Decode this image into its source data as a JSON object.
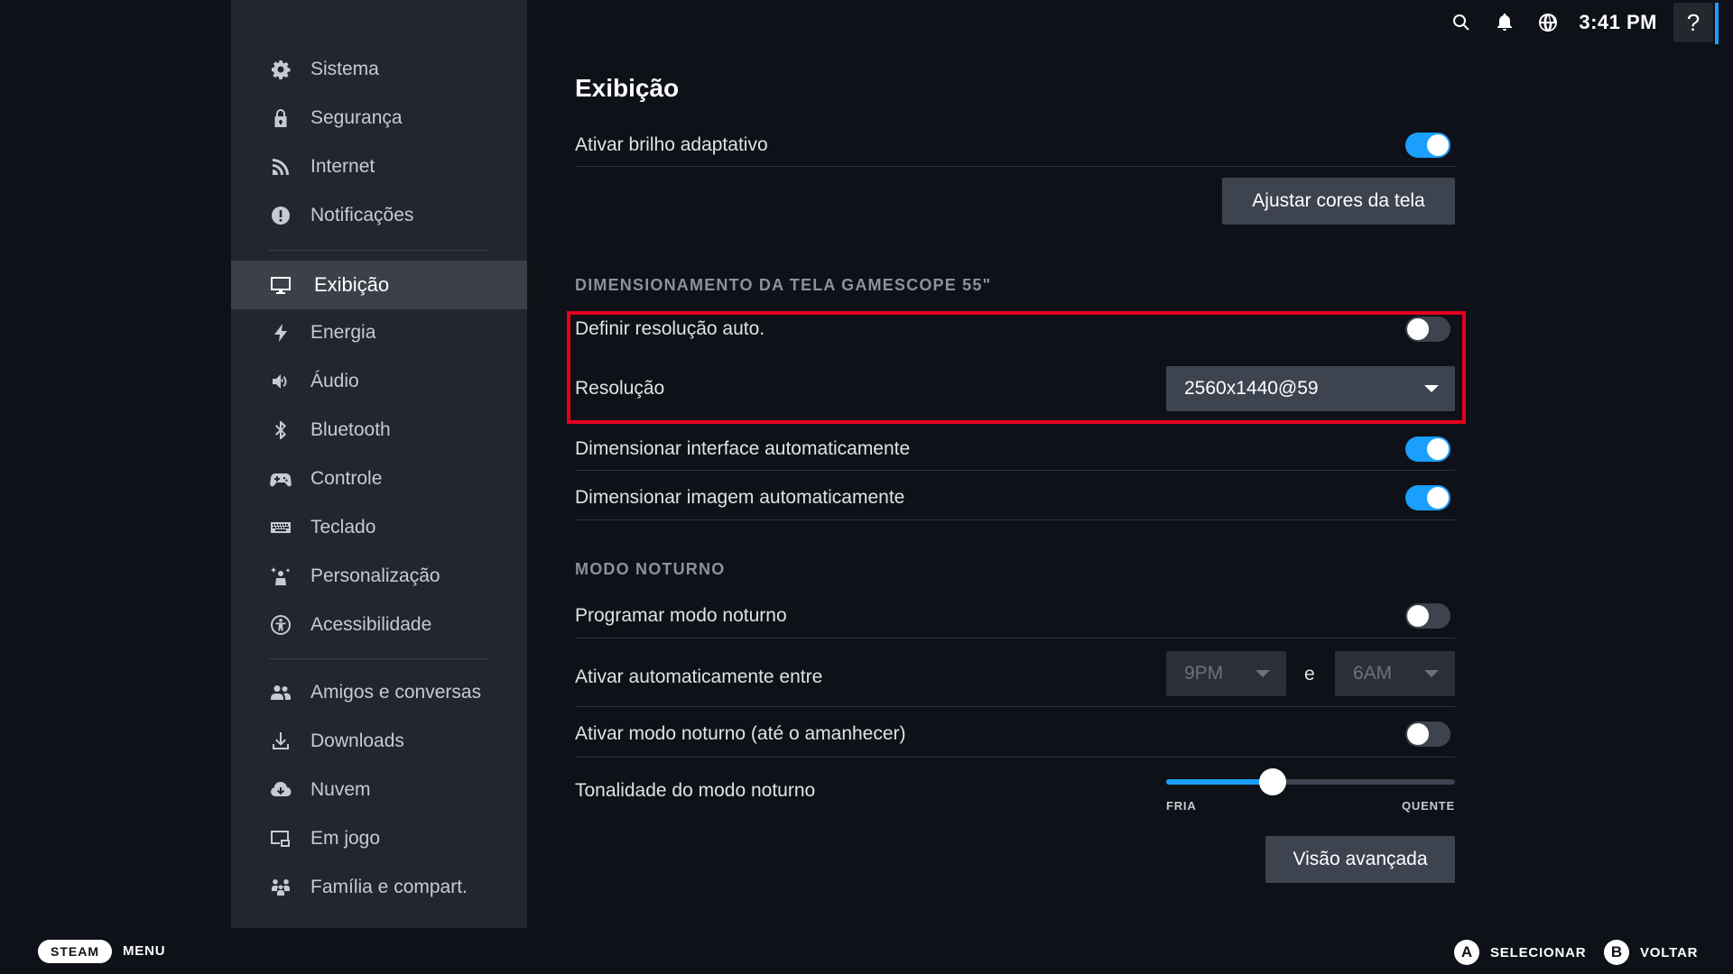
{
  "topbar": {
    "clock": "3:41 PM",
    "help_label": "?",
    "icons": [
      "search-icon",
      "bell-icon",
      "globe-icon"
    ]
  },
  "sidebar": {
    "items": [
      {
        "label": "Sistema",
        "icon": "gear-icon"
      },
      {
        "label": "Segurança",
        "icon": "lock-icon"
      },
      {
        "label": "Internet",
        "icon": "wifi-icon"
      },
      {
        "label": "Notificações",
        "icon": "alert-icon"
      },
      {
        "label": "Exibição",
        "icon": "monitor-icon",
        "active": true
      },
      {
        "label": "Energia",
        "icon": "lightning-icon"
      },
      {
        "label": "Áudio",
        "icon": "speaker-icon"
      },
      {
        "label": "Bluetooth",
        "icon": "bluetooth-icon"
      },
      {
        "label": "Controle",
        "icon": "gamepad-icon"
      },
      {
        "label": "Teclado",
        "icon": "keyboard-icon"
      },
      {
        "label": "Personalização",
        "icon": "sparkle-icon"
      },
      {
        "label": "Acessibilidade",
        "icon": "accessibility-icon"
      },
      {
        "label": "Amigos e conversas",
        "icon": "friends-icon"
      },
      {
        "label": "Downloads",
        "icon": "download-icon"
      },
      {
        "label": "Nuvem",
        "icon": "cloud-icon"
      },
      {
        "label": "Em jogo",
        "icon": "ingame-icon"
      },
      {
        "label": "Família e compart.",
        "icon": "family-icon"
      }
    ]
  },
  "main": {
    "title": "Exibição",
    "adaptive_brightness": {
      "label": "Ativar brilho adaptativo",
      "on": true
    },
    "adjust_colors_button": "Ajustar cores da tela",
    "scaling_section": "DIMENSIONAMENTO DA TELA GAMESCOPE 55\"",
    "auto_resolution": {
      "label": "Definir resolução auto.",
      "on": false
    },
    "resolution": {
      "label": "Resolução",
      "value": "2560x1440@59"
    },
    "auto_scale_ui": {
      "label": "Dimensionar interface automaticamente",
      "on": true
    },
    "auto_scale_image": {
      "label": "Dimensionar imagem automaticamente",
      "on": true
    },
    "night_section": "MODO NOTURNO",
    "schedule_night": {
      "label": "Programar modo noturno",
      "on": false
    },
    "auto_between": {
      "label": "Ativar automaticamente entre",
      "from": "9PM",
      "and": "e",
      "to": "6AM"
    },
    "night_until_dawn": {
      "label": "Ativar modo noturno (até o amanhecer)",
      "on": false
    },
    "night_tint": {
      "label": "Tonalidade do modo noturno",
      "min_label": "FRIA",
      "max_label": "QUENTE",
      "value": 0.37
    },
    "advanced_button": "Visão avançada"
  },
  "bottombar": {
    "steam": "STEAM",
    "menu": "MENU",
    "a_key": "A",
    "select": "SELECIONAR",
    "b_key": "B",
    "back": "VOLTAR"
  },
  "colors": {
    "accent": "#1a9fff",
    "highlight": "#e5001f"
  }
}
